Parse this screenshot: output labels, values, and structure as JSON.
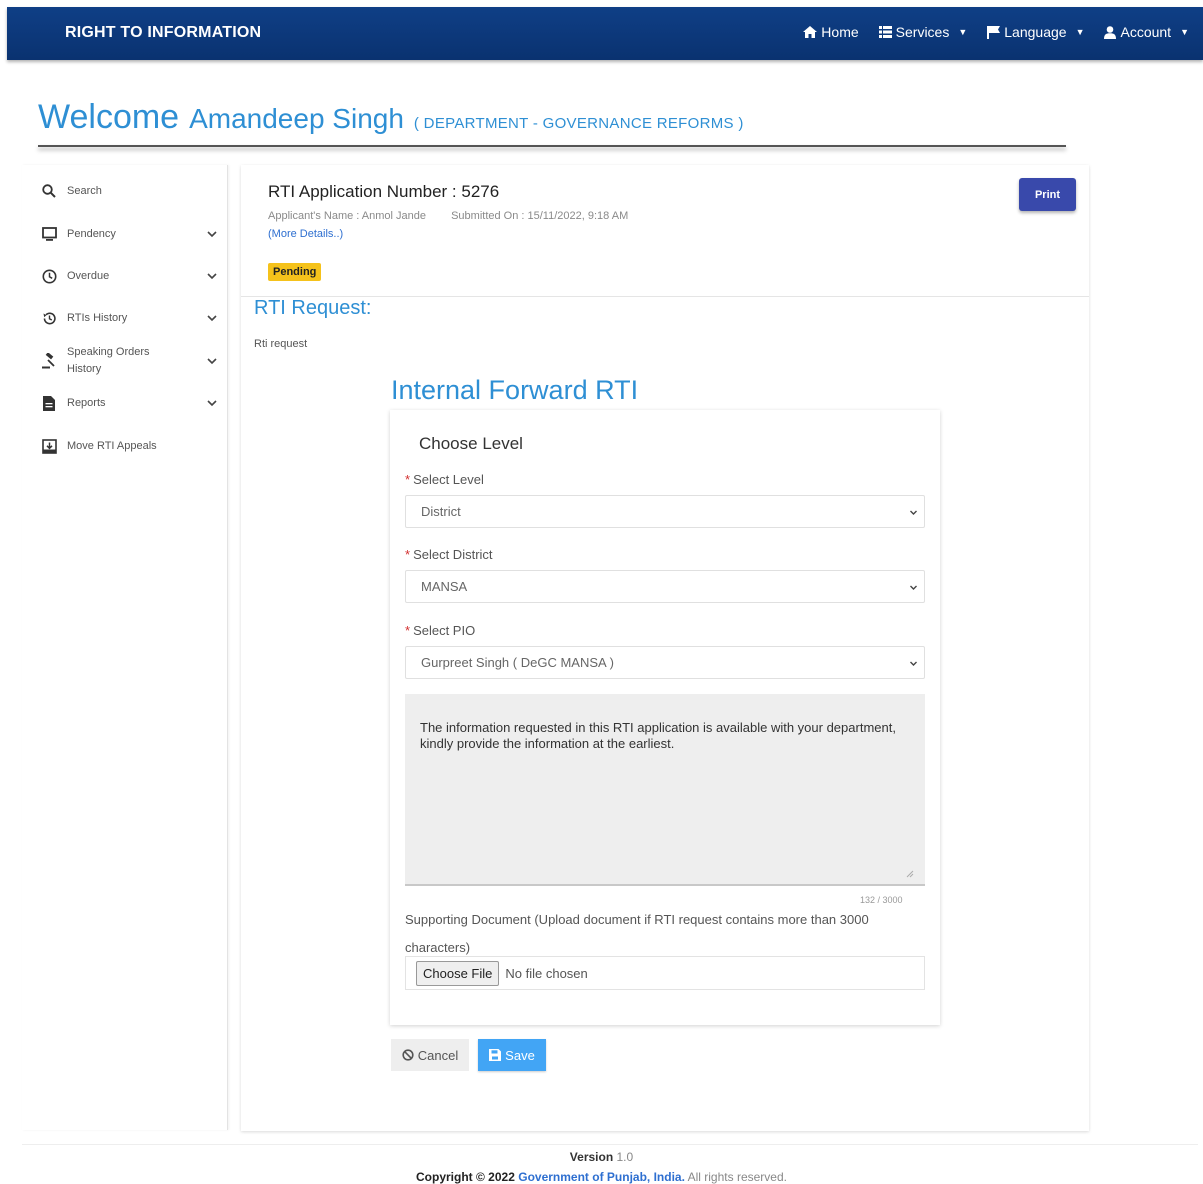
{
  "navbar": {
    "brand": "RIGHT TO INFORMATION",
    "items": [
      {
        "label": "Home",
        "icon": "home-icon"
      },
      {
        "label": "Services",
        "icon": "list-icon"
      },
      {
        "label": "Language",
        "icon": "flag-icon"
      },
      {
        "label": "Account",
        "icon": "user-icon"
      }
    ]
  },
  "welcome": {
    "greeting": "Welcome",
    "user_name": "Amandeep Singh",
    "department": "( DEPARTMENT - GOVERNANCE REFORMS )"
  },
  "sidebar": {
    "items": [
      {
        "label": "Search",
        "icon": "search-icon"
      },
      {
        "label": "Pendency",
        "icon": "monitor-icon"
      },
      {
        "label": "Overdue",
        "icon": "clock-icon"
      },
      {
        "label": "RTIs History",
        "icon": "history-icon"
      },
      {
        "label": "Speaking Orders History",
        "icon": "gavel-icon"
      },
      {
        "label": "Reports",
        "icon": "document-icon"
      },
      {
        "label": "Move RTI Appeals",
        "icon": "move-icon"
      }
    ]
  },
  "application": {
    "title": "RTI Application Number : 5276",
    "applicant": "Applicant's Name : Anmol Jande",
    "submitted": "Submitted On : 15/11/2022, 9:18 AM",
    "more_details": "(More Details..)",
    "status": "Pending",
    "print_label": "Print",
    "status_color": "#f5c21b"
  },
  "rti_request": {
    "heading": "RTI Request:",
    "text": "Rti request"
  },
  "forward": {
    "heading": "Internal Forward RTI",
    "card_title": "Choose Level",
    "level_label": "Select Level",
    "level_value": "District",
    "district_label": "Select District",
    "district_value": "MANSA",
    "pio_label": "Select PIO",
    "pio_value": "Gurpreet Singh ( DeGC MANSA )",
    "message": "The information requested in this RTI application is available with your department, kindly provide the information at the earliest.",
    "counter": "132 / 3000",
    "support_text": "Supporting Document (Upload document if RTI request contains more than 3000 characters)",
    "choose_file": "Choose File",
    "no_file": "No file chosen",
    "cancel_label": "Cancel",
    "save_label": "Save"
  },
  "footer": {
    "version_label": "Version",
    "version_number": "1.0",
    "copyright": "Copyright © 2022",
    "org": "Government of Punjab, India.",
    "rights": "All rights reserved."
  },
  "colors": {
    "navbar": "#0f3f86",
    "accent": "#2e8fd4",
    "print": "#3949ab",
    "save": "#42a5f5"
  }
}
